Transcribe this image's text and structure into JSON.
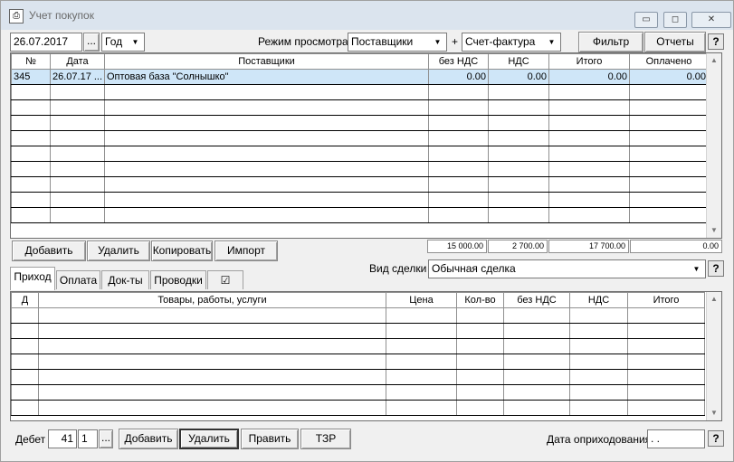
{
  "window": {
    "title": "Учет покупок",
    "min_glyph": "▭",
    "max_glyph": "◻",
    "close_glyph": "✕"
  },
  "toolbar": {
    "date": "26.07.2017",
    "ellipsis": "...",
    "period": "Год",
    "view_mode_label": "Режим просмотра:",
    "view_mode": "Поставщики",
    "plus": "+",
    "doc_type": "Счет-фактура",
    "filter": "Фильтр",
    "reports": "Отчеты",
    "help": "?"
  },
  "main_table": {
    "headers": [
      "№",
      "Дата",
      "Поставщики",
      "без НДС",
      "НДС",
      "Итого",
      "Оплачено"
    ],
    "rows": [
      [
        "345",
        "26.07.17 ...",
        "Оптовая база \"Солнышко\"",
        "0.00",
        "0.00",
        "0.00",
        "0.00"
      ]
    ],
    "totals": [
      "15 000.00",
      "2 700.00",
      "17 700.00",
      "0.00"
    ]
  },
  "main_buttons": {
    "add": "Добавить",
    "delete": "Удалить",
    "copy": "Копировать",
    "import": "Импорт"
  },
  "deal": {
    "label": "Вид сделки",
    "value": "Обычная сделка",
    "help": "?"
  },
  "tabs": [
    "Приход",
    "Оплата",
    "Док-ты",
    "Проводки",
    "☑"
  ],
  "items_table": {
    "headers": [
      "Д",
      "Товары, работы, услуги",
      "Цена",
      "Кол-во",
      "без НДС",
      "НДС",
      "Итого"
    ]
  },
  "bottom": {
    "debit_label": "Дебет",
    "debit_account": "41",
    "debit_sub": "1",
    "ellipsis": "...",
    "add": "Добавить",
    "delete": "Удалить",
    "edit": "Править",
    "tzr": "ТЗР",
    "receipt_date_label": "Дата оприходования",
    "receipt_date": " .  . ",
    "help": "?"
  }
}
